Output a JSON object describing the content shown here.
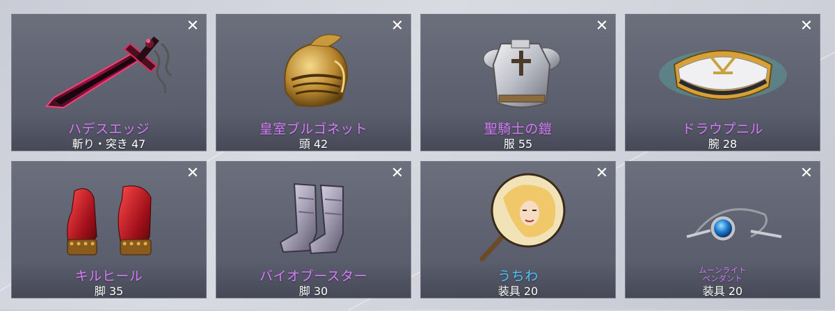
{
  "close_label": "✕",
  "items": [
    {
      "name": "ハデスエッジ",
      "stat": "斬り・突き 47",
      "name_color": "#d77bff",
      "icon": "demonic-sword-icon"
    },
    {
      "name": "皇室ブルゴネット",
      "stat": "頭 42",
      "name_color": "#d77bff",
      "icon": "golden-helmet-icon"
    },
    {
      "name": "聖騎士の鎧",
      "stat": "服 55",
      "name_color": "#d77bff",
      "icon": "paladin-armor-icon"
    },
    {
      "name": "ドラウプニル",
      "stat": "腕 28",
      "name_color": "#d77bff",
      "icon": "gold-bracelet-icon"
    },
    {
      "name": "キルヒール",
      "stat": "脚 35",
      "name_color": "#d77bff",
      "icon": "red-heels-icon"
    },
    {
      "name": "バイオブースター",
      "stat": "脚 30",
      "name_color": "#d77bff",
      "icon": "bio-boots-icon"
    },
    {
      "name": "うちわ",
      "stat": "装具 20",
      "name_color": "#4fc4ff",
      "icon": "fan-icon"
    },
    {
      "name": "ムーンライト ペンダント",
      "stat": "装具 20",
      "name_color": "#d77bff",
      "icon": "pendant-icon"
    }
  ]
}
